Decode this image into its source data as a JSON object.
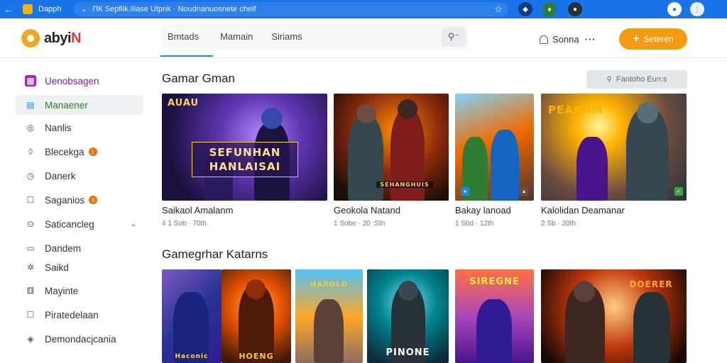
{
  "browser": {
    "tab_title": "Daрph",
    "url": "ПК Sepfiik.iliase Utpnk · Noudnanuosnete cheif",
    "back_icon": "arrow-left-icon",
    "star_icon": "star-icon"
  },
  "header": {
    "logo_text": "abyi",
    "logo_accent": "N",
    "tabs": [
      {
        "label": "Bmtads",
        "active": true
      },
      {
        "label": "Mamain",
        "active": false
      },
      {
        "label": "Siriams",
        "active": false
      }
    ],
    "search_icon": "search-key-icon",
    "user_name": "Sonna",
    "more": "···",
    "cta_label": "Seteren",
    "cta_plus": "+",
    "accent_color": "#f39c12"
  },
  "sidebar": {
    "items": [
      {
        "label": "Uenobsagen",
        "icon": "grid-icon",
        "badge": null
      },
      {
        "label": "Manaener",
        "icon": "calendar-icon",
        "badge": null
      },
      {
        "label": "Nanlis",
        "icon": "tag-icon",
        "badge": null
      },
      {
        "label": "Blecekga",
        "icon": "leaf-icon",
        "badge": "1"
      },
      {
        "label": "Danerk",
        "icon": "clock-icon",
        "badge": null
      },
      {
        "label": "Saganios",
        "icon": "square-icon",
        "badge": "0"
      },
      {
        "label": "Saticancleg",
        "icon": "location-icon",
        "badge": null,
        "chevron": "⌄"
      },
      {
        "label": "Dandem",
        "icon": "card-icon",
        "badge": null
      },
      {
        "label": "Saikd",
        "icon": "gear-icon",
        "badge": null
      },
      {
        "label": "Mayinte",
        "icon": "dice-icon",
        "badge": null
      },
      {
        "label": "Piratedelaan",
        "icon": "doc-icon",
        "badge": null
      },
      {
        "label": "Demondacjcania",
        "icon": "compass-icon",
        "badge": null
      }
    ]
  },
  "main": {
    "section1_title": "Gamar Gman",
    "sort_label": "Fantoho Eun:s",
    "section2_title": "Gamegrhar Katarns",
    "row1": [
      {
        "title": "Saikaol Amalanm",
        "meta": "4 1 Sob · 70th",
        "banner": "SEFUNHAN\nHANLAISAI",
        "corner": "AUAU"
      },
      {
        "title": "Geokola Natand",
        "meta": "1 Sobe · 20 :Sth",
        "banner": "SEHANGHUIS",
        "corner": ""
      },
      {
        "title": "Bakay lanoad",
        "meta": "1 Sbd · 12th",
        "banner": "",
        "corner": ""
      },
      {
        "title": "Kalolidan Deamanar",
        "meta": "2 Sb · 20th",
        "banner": "",
        "corner": "PEAKAM"
      }
    ],
    "row2": [
      {
        "banner": "Haconic"
      },
      {
        "banner": "HOENG"
      },
      {
        "banner": "HAROLD"
      },
      {
        "banner": "PINONE"
      },
      {
        "banner": "SIREGNE"
      },
      {
        "banner": "DOERER"
      }
    ]
  }
}
